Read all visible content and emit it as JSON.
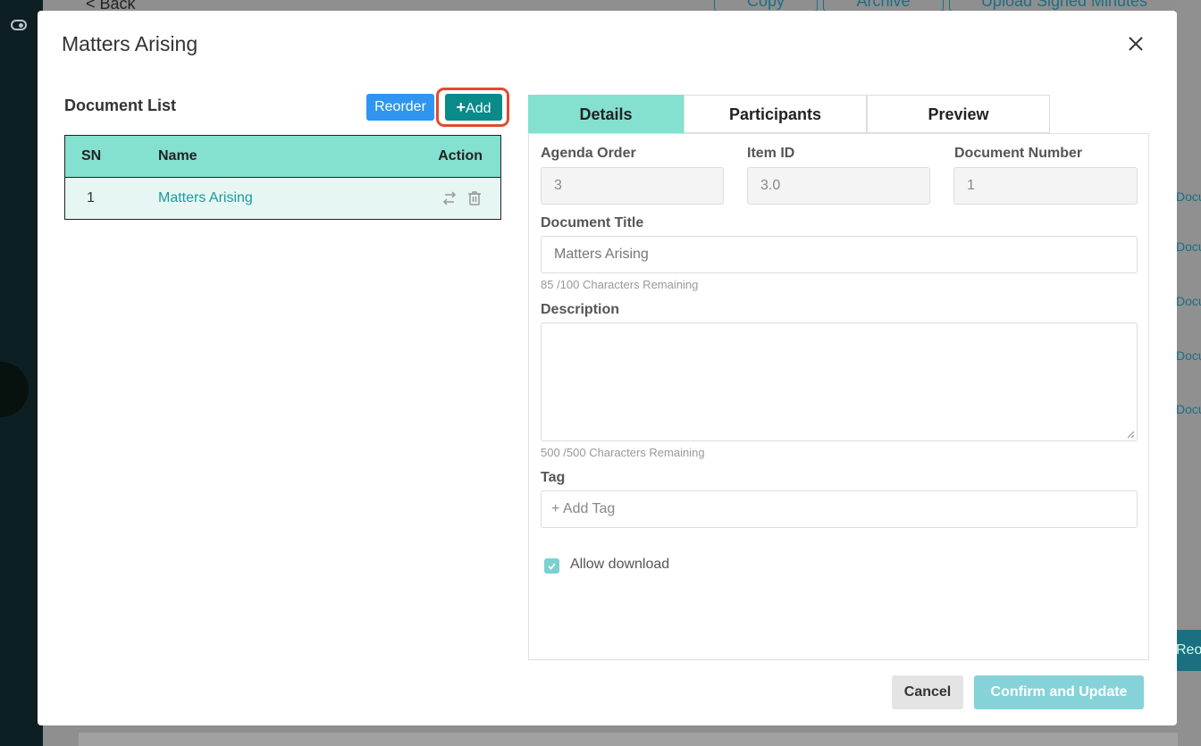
{
  "background": {
    "back_label": "< Back",
    "header_buttons": [
      "Copy",
      "Archive",
      "Upload Signed Minutes"
    ],
    "right_column_cells": [
      "Docu",
      "Docu",
      "Docu",
      "Docu",
      "Docu"
    ],
    "reorder_label": "Reor"
  },
  "modal": {
    "title": "Matters Arising",
    "close_icon": "close-icon"
  },
  "document_list": {
    "title": "Document List",
    "reorder_label": "Reorder",
    "add_label": "Add",
    "add_icon": "plus-icon",
    "columns": [
      "SN",
      "Name",
      "Action"
    ],
    "rows": [
      {
        "sn": "1",
        "name": "Matters Arising",
        "actions": [
          "swap-icon",
          "trash-icon"
        ]
      }
    ]
  },
  "tabs": [
    {
      "label": "Details",
      "active": true
    },
    {
      "label": "Participants",
      "active": false
    },
    {
      "label": "Preview",
      "active": false
    }
  ],
  "details": {
    "agenda_order": {
      "label": "Agenda Order",
      "value": "3"
    },
    "item_id": {
      "label": "Item ID",
      "value": "3.0"
    },
    "document_number": {
      "label": "Document Number",
      "value": "1"
    },
    "document_title": {
      "label": "Document Title",
      "value": "Matters Arising",
      "hint": "85 /100 Characters Remaining"
    },
    "description": {
      "label": "Description",
      "value": "",
      "hint": "500 /500 Characters Remaining"
    },
    "tag": {
      "label": "Tag",
      "placeholder": "+ Add Tag"
    },
    "allow_download": {
      "label": "Allow download",
      "checked": true
    }
  },
  "footer": {
    "cancel_label": "Cancel",
    "confirm_label": "Confirm and Update"
  },
  "colors": {
    "accent_teal": "#0a8b8a",
    "reorder_blue": "#2e96f0",
    "table_header": "#84e0cf",
    "highlight": "#e34a2e"
  }
}
